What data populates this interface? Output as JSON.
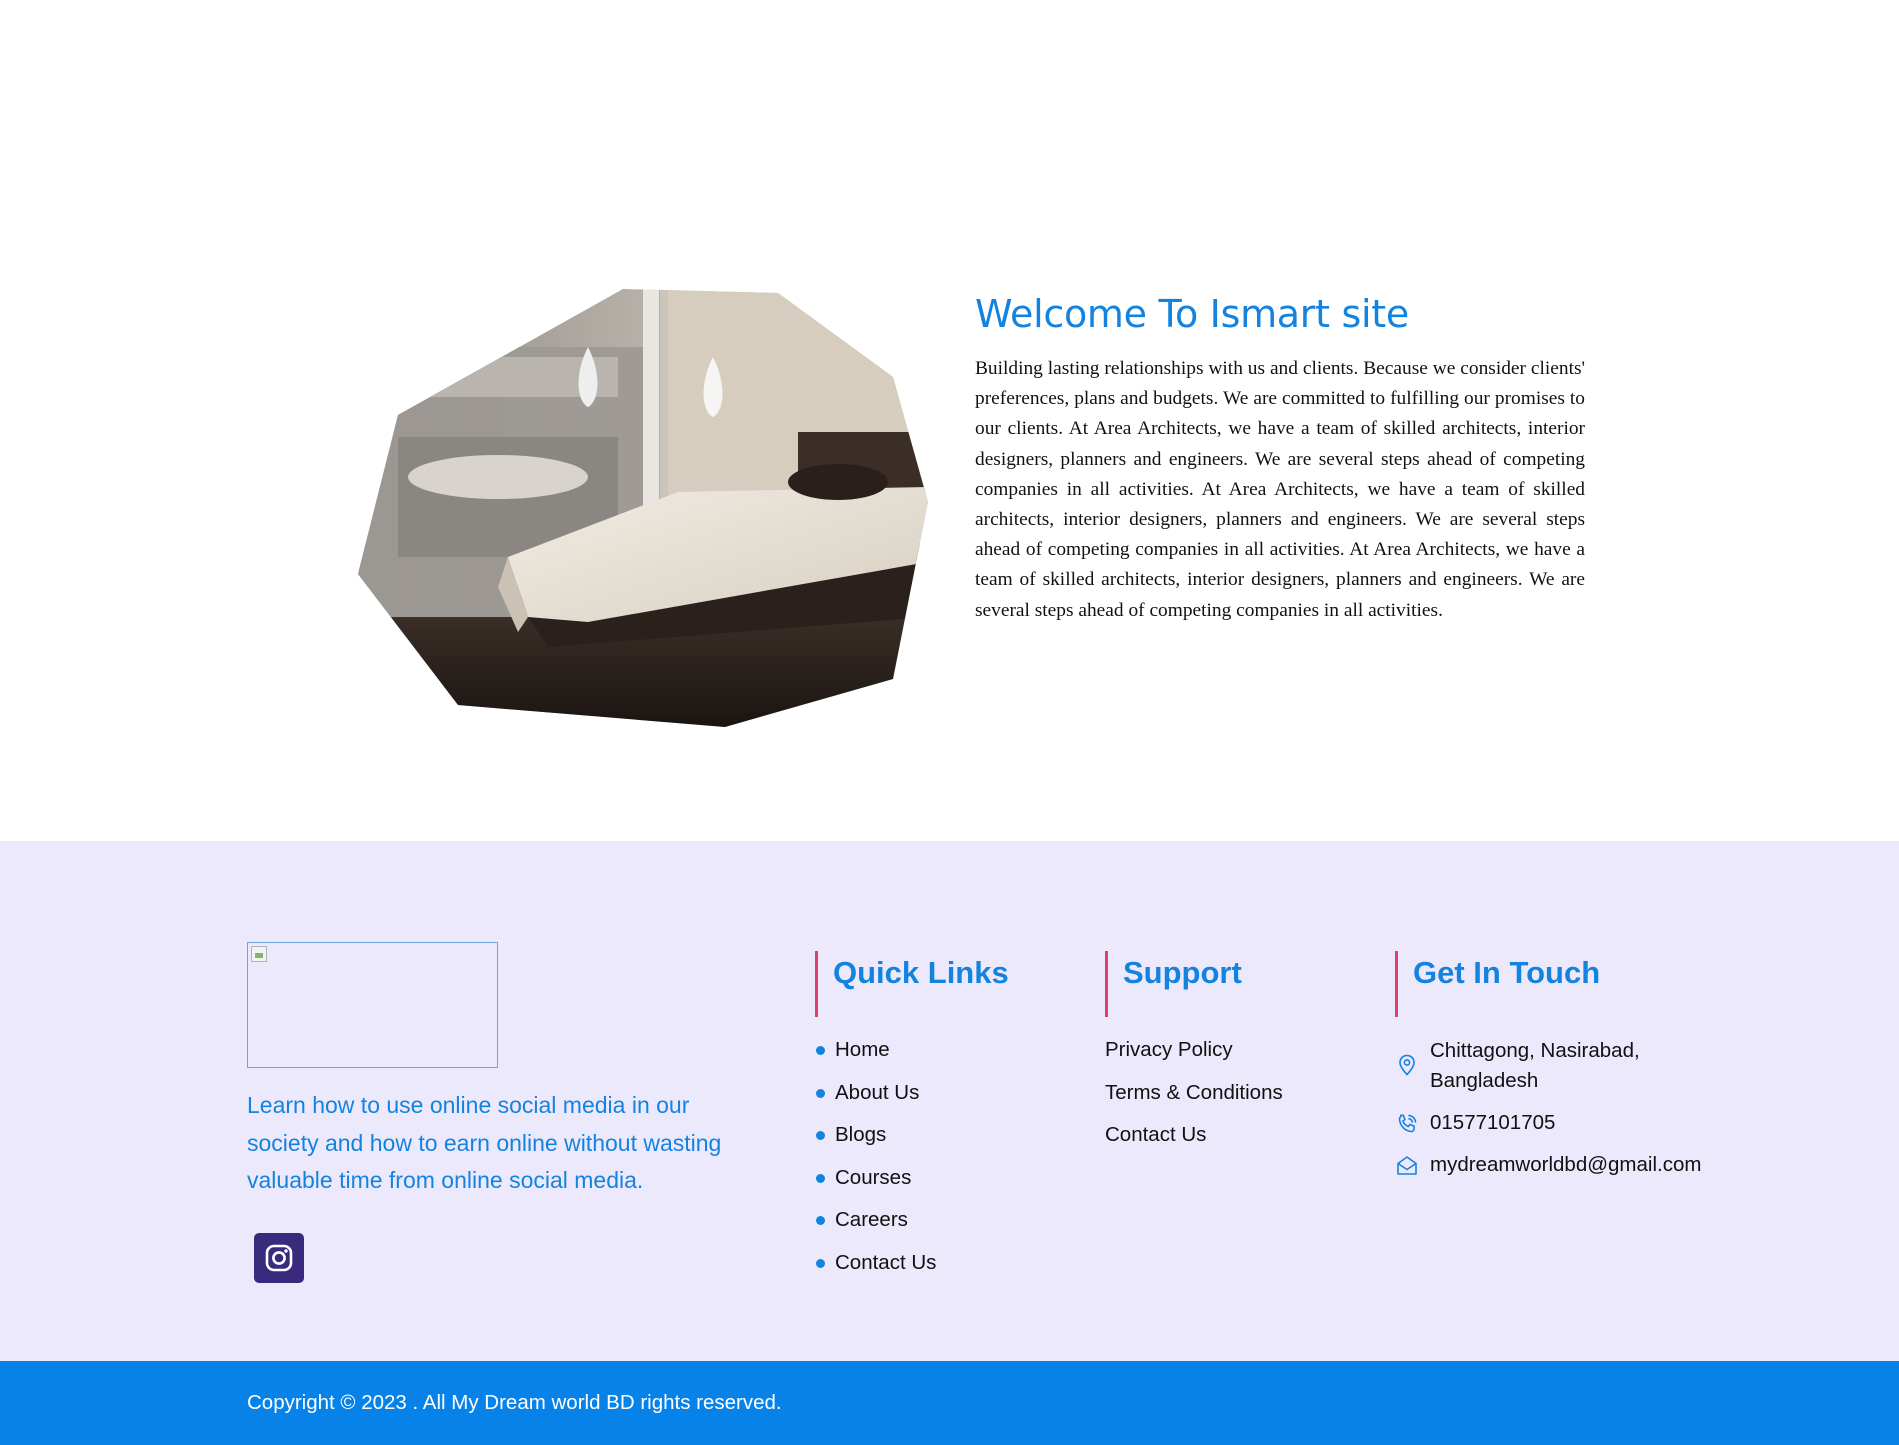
{
  "about": {
    "title": "Welcome To Ismart site",
    "body": "Building lasting relationships with us and clients.  Because we consider clients' preferences, plans and budgets.  We are committed to fulfilling our promises to our clients. At Area Architects, we have a team of skilled architects, interior designers, planners and engineers.  We are several steps ahead of competing companies in all activities. At Area Architects, we have a team of skilled architects, interior designers, planners and engineers.  We are several steps ahead of competing companies in all activities. At Area Architects, we have a team of skilled architects, interior designers, planners and engineers.  We are several steps ahead of competing companies in all activities.",
    "image_icon": "bedroom-photo"
  },
  "footer": {
    "description": "Learn how to use online social media in our society and how to earn online without wasting valuable time from online social media.",
    "social": [
      {
        "icon": "instagram-icon"
      }
    ],
    "quick_links": {
      "title": "Quick Links",
      "items": [
        "Home",
        "About Us",
        "Blogs",
        "Courses",
        "Careers",
        "Contact Us"
      ]
    },
    "support": {
      "title": "Support",
      "items": [
        "Privacy Policy",
        "Terms & Conditions",
        "Contact Us"
      ]
    },
    "get_in_touch": {
      "title": "Get In Touch",
      "address": "Chittagong, Nasirabad, Bangladesh",
      "phone": "01577101705",
      "email": "mydreamworldbd@gmail.com"
    }
  },
  "copyright": "Copyright © 2023 . All My Dream world BD rights reserved.",
  "colors": {
    "accent": "#1483e0",
    "footer_bg": "#ece9fc",
    "copyright_bg": "#0782e9",
    "heading_border": "#e43d6a",
    "social_bg": "#3a2a7d"
  }
}
